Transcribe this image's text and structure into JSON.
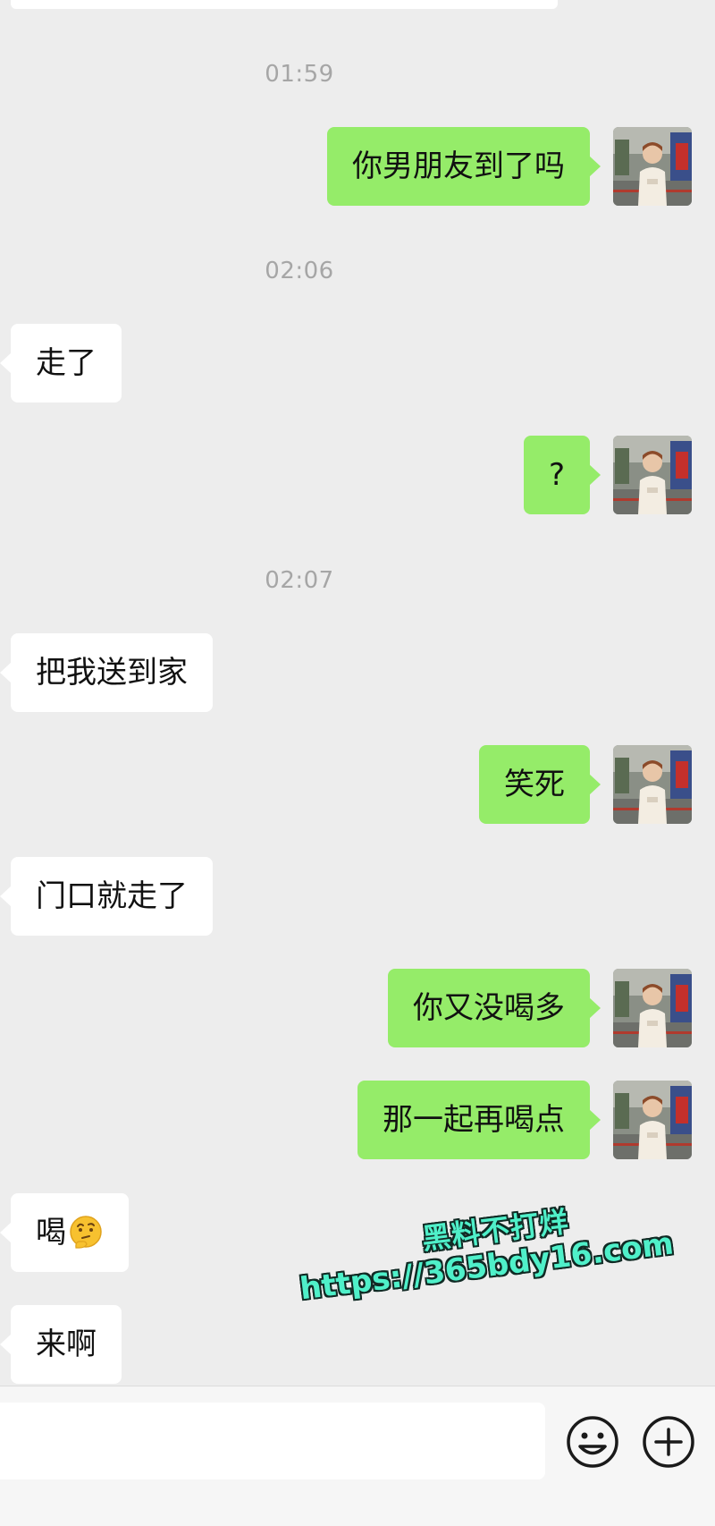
{
  "timestamps": [
    "01:59",
    "02:06",
    "02:07"
  ],
  "messages": [
    {
      "text": "你男朋友到了吗",
      "side": "out"
    },
    {
      "text": "走了",
      "side": "in"
    },
    {
      "text": "?",
      "side": "out"
    },
    {
      "text": "把我送到家",
      "side": "in"
    },
    {
      "text": "笑死",
      "side": "out"
    },
    {
      "text": "门口就走了",
      "side": "in"
    },
    {
      "text": "你又没喝多",
      "side": "out"
    },
    {
      "text": "那一起再喝点",
      "side": "out"
    },
    {
      "text": "喝",
      "side": "in",
      "emoji": "thinking-face-icon"
    },
    {
      "text": "来啊",
      "side": "in"
    }
  ],
  "watermark": {
    "line1": "黑料不打烊",
    "line2": "https://365bdy16.com"
  },
  "input_bar": {
    "placeholder": "",
    "icons": [
      "smiley-icon",
      "plus-circle-icon"
    ]
  },
  "colors": {
    "background": "#ededed",
    "outgoing_bubble": "#95ec69",
    "incoming_bubble": "#ffffff",
    "timestamp": "#a6a6a6",
    "watermark": "#4ff0c9"
  }
}
